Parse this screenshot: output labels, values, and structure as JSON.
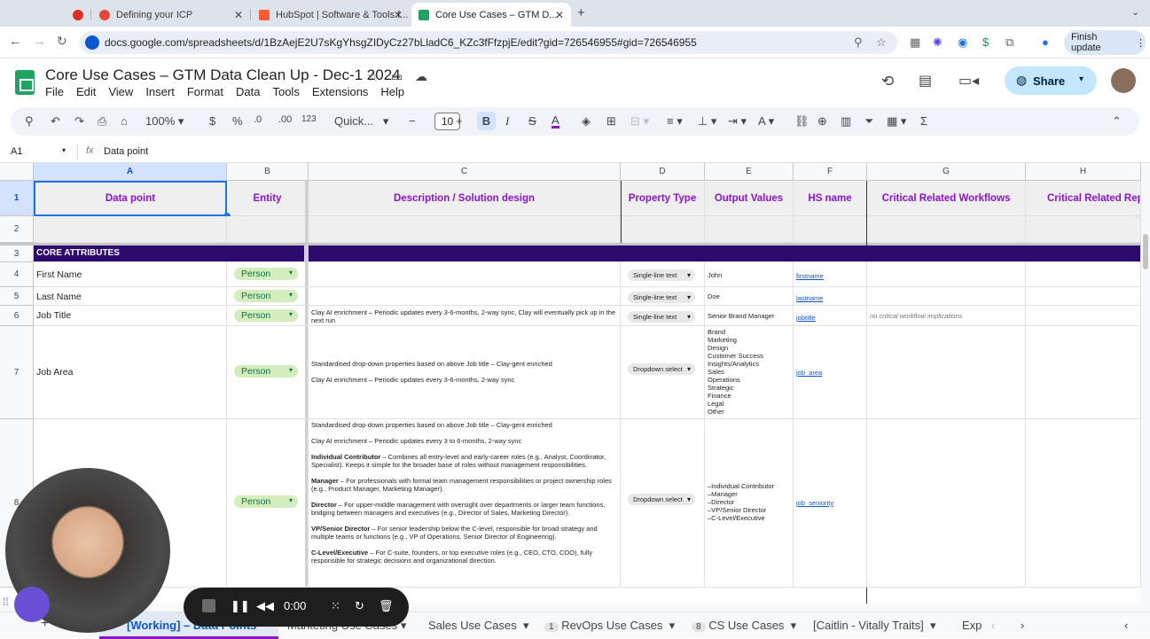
{
  "browser": {
    "tabs": [
      {
        "label": ""
      },
      {
        "label": "Defining your ICP"
      },
      {
        "label": "HubSpot | Software & Tools f..."
      },
      {
        "label": "Core Use Cases – GTM D..."
      }
    ],
    "url": "docs.google.com/spreadsheets/d/1BzAejE2U7sKgYhsgZIDyCz27bLladC6_KZc3fFfzpjE/edit?gid=726546955#gid=726546955",
    "finish_update": "Finish update"
  },
  "doc": {
    "title": "Core Use Cases – GTM Data Clean Up - Dec-1 2024",
    "menu": [
      "File",
      "Edit",
      "View",
      "Insert",
      "Format",
      "Data",
      "Tools",
      "Extensions",
      "Help"
    ],
    "share_label": "Share"
  },
  "toolbar": {
    "zoom": "100%",
    "currency": "$",
    "percent": "%",
    "dec_decrease": ".0",
    "dec_increase": ".00",
    "number_format": "123",
    "font": "Quick...",
    "font_size": "10"
  },
  "formula_bar": {
    "cell_ref": "A1",
    "fx": "fx",
    "value": "Data point"
  },
  "columns": [
    "A",
    "B",
    "C",
    "D",
    "E",
    "F",
    "G",
    "H"
  ],
  "header_row": {
    "a": "Data point",
    "b": "Entity",
    "c": "Description / Solution design",
    "d": "Property Type",
    "e": "Output Values",
    "f": "HS name",
    "g": "Critical Related Workflows",
    "h": "Critical Related Rep"
  },
  "section_label": "CORE ATTRIBUTES",
  "rows": [
    {
      "num": "4",
      "a": "First Name",
      "b": "Person",
      "c": "",
      "d": "Single-line text",
      "e": "John",
      "f": "firstname",
      "g": ""
    },
    {
      "num": "5",
      "a": "Last Name",
      "b": "Person",
      "c": "",
      "d": "Single-line text",
      "e": "Doe",
      "f": "lastname",
      "g": ""
    },
    {
      "num": "6",
      "a": "Job Title",
      "b": "Person",
      "c": "Clay AI enrichment – Periodic updates every 3-6-months, 2-way sync, Clay will eventually pick up in the next run",
      "d": "Single-line text",
      "e": "Senior Brand Manager",
      "f": "jobtitle",
      "g": "no critical workflow implications"
    },
    {
      "num": "7",
      "a": "Job Area",
      "b": "Person",
      "c1": "Standardised drop-down properties based on above Job title – Clay-gent enriched",
      "c2": "Clay AI enrichment – Periodic updates every 3-6-months, 2-way sync",
      "d": "Dropdown select",
      "e": [
        "Brand",
        "Marketing",
        "Design",
        "Customer Success",
        "Insights/Analytics",
        "Sales",
        "Operations",
        "Strategic",
        "Finance",
        "Legal",
        "Other"
      ],
      "f": "job_area",
      "g": ""
    },
    {
      "num": "8",
      "a": "",
      "b": "Person",
      "c1": "Standardised drop-down properties based on above Job title – Clay-gent enriched",
      "c2": "Clay AI enrichment – Periodic updates every 3 to 6-months, 2-way sync",
      "d": "Dropdown select",
      "e": [
        "–Individual Contributor",
        "–Manager",
        "–Director",
        "–VP/Senior Director",
        "–C-Level/Executive"
      ],
      "f": "job_seniority",
      "g": "",
      "c_items": [
        {
          "term": "Individual Contributor",
          "text": " – Combines all entry-level and early-career roles (e.g., Analyst, Coordinator, Specialist). Keeps it simple for the broader base of roles without management responsibilities."
        },
        {
          "term": "Manager",
          "text": " – For professionals with formal team management responsibilities or project ownership roles (e.g., Product Manager, Marketing Manager)."
        },
        {
          "term": "Director",
          "text": " – For upper-middle management with oversight over departments or larger team functions, bridging between managers and executives (e.g., Director of Sales, Marketing Director)."
        },
        {
          "term": "VP/Senior Director",
          "text": " – For senior leadership below the C-level, responsible for broad strategy and multiple teams or functions (e.g., VP of Operations, Senior Director of Engineering)."
        },
        {
          "term": "C-Level/Executive",
          "text": " – For C-suite, founders, or top executive roles (e.g., CEO, CTO, COO), fully responsible for strategic decisions and organizational direction."
        }
      ]
    }
  ],
  "row_numbers": [
    "1",
    "2",
    "3"
  ],
  "sheet_tabs": [
    {
      "label": "[Working] – Data Points"
    },
    {
      "label": "Marketing Use Cases"
    },
    {
      "label": "Sales Use Cases"
    },
    {
      "label": "RevOps Use Cases",
      "badge": "1"
    },
    {
      "label": "CS Use Cases",
      "badge": "8"
    },
    {
      "label": "[Caitlin - Vitally Traits]"
    },
    {
      "label": "Exp"
    }
  ],
  "recording": {
    "timer": "0:00"
  },
  "colors": {
    "accent_purple": "#8a14c9",
    "section_bar": "#2d0a6d",
    "chip_green": "#d4edbc"
  }
}
